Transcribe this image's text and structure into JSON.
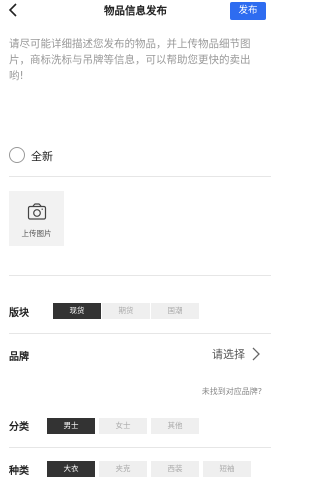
{
  "header": {
    "title": "物品信息发布",
    "publish_label": "发布"
  },
  "description": "请尽可能详细描述您发布的物品，并上传物品细节图片，商标洗标与吊牌等信息，可以帮助您更快的卖出哟!",
  "condition": {
    "label": "全新"
  },
  "upload": {
    "label": "上传图片"
  },
  "sections": {
    "block": {
      "label": "版块",
      "options": [
        "现货",
        "期货",
        "国潮"
      ],
      "selected": "现货"
    },
    "brand": {
      "label": "品牌",
      "select_label": "请选择",
      "missing_link": "未找到对应品牌?"
    },
    "category": {
      "label": "分类",
      "options": [
        "男士",
        "女士",
        "其他"
      ],
      "selected": "男士"
    },
    "type": {
      "label": "种类",
      "options": [
        "大衣",
        "夹克",
        "西装",
        "短袖"
      ],
      "selected": "大衣"
    }
  }
}
